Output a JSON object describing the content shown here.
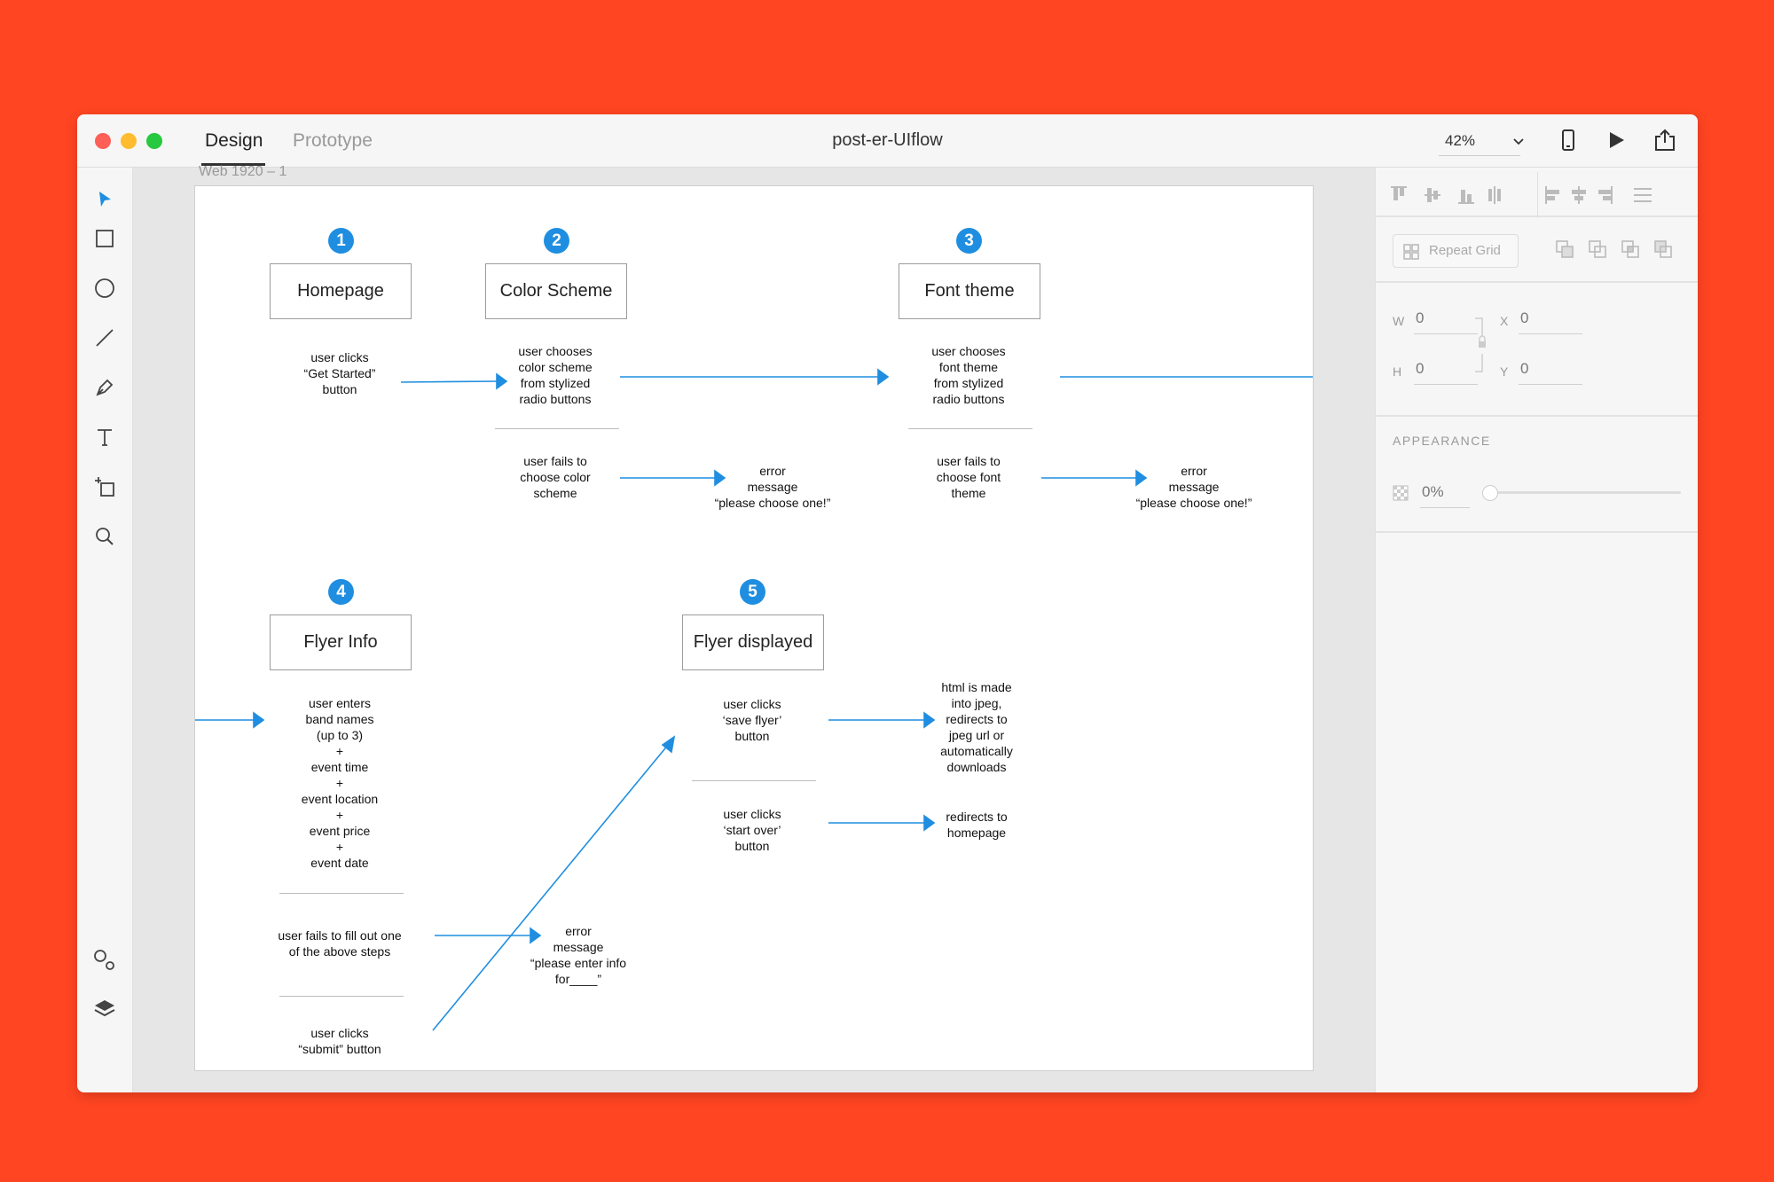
{
  "window": {
    "tabs": {
      "design": "Design",
      "prototype": "Prototype"
    },
    "title": "post-er-UIflow",
    "zoom": "42%",
    "colors": {
      "accent": "#1f8ee0",
      "background": "#ff4522",
      "close": "#fe5f57",
      "minimize": "#febc2e",
      "maximize": "#28c840"
    }
  },
  "toolbar": {
    "tools": [
      "select-icon",
      "rectangle-icon",
      "ellipse-icon",
      "line-icon",
      "pen-icon",
      "text-icon",
      "artboard-icon",
      "zoom-icon"
    ],
    "bottom": [
      "symbols-icon",
      "layers-icon"
    ]
  },
  "canvas": {
    "artboard_label": "Web 1920 – 1"
  },
  "panel": {
    "repeat_grid": "Repeat Grid",
    "w_label": "W",
    "w_value": "0",
    "h_label": "H",
    "h_value": "0",
    "x_label": "X",
    "x_value": "0",
    "y_label": "Y",
    "y_value": "0",
    "appearance": "APPEARANCE",
    "opacity": "0%"
  },
  "flow": {
    "steps": [
      {
        "num": "1",
        "label": "Homepage"
      },
      {
        "num": "2",
        "label": "Color Scheme"
      },
      {
        "num": "3",
        "label": "Font theme"
      },
      {
        "num": "4",
        "label": "Flyer Info"
      },
      {
        "num": "5",
        "label": "Flyer displayed"
      }
    ],
    "notes": {
      "home_action": "user clicks\n“Get Started”\nbutton",
      "color_action": "user chooses\ncolor scheme\nfrom stylized\nradio buttons",
      "color_fail": "user fails to\nchoose color\nscheme",
      "color_error": "error\nmessage\n“please choose one!”",
      "font_action": "user chooses\nfont theme\nfrom stylized\nradio buttons",
      "font_fail": "user fails to\nchoose font\ntheme",
      "font_error": "error\nmessage\n“please choose one!”",
      "info_action": "user enters\nband names\n(up to 3)\n+\nevent time\n+\nevent location\n+\nevent price\n+\nevent date",
      "info_fail": "user fails to fill out one\nof the above steps",
      "info_error": "error\nmessage\n“please enter info\nfor____”",
      "info_submit": "user clicks\n“submit” button",
      "save_action": "user clicks\n‘save flyer’\nbutton",
      "save_result": "html is made\ninto jpeg,\nredirects to\njpeg url or\nautomatically\ndownloads",
      "startover_action": "user clicks\n‘start over’\nbutton",
      "startover_result": "redirects to\nhomepage"
    }
  }
}
